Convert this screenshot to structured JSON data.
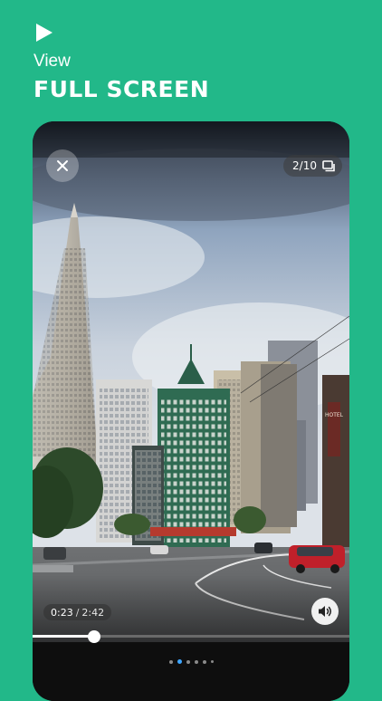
{
  "header": {
    "subtitle": "View",
    "title": "FULL SCREEN"
  },
  "viewer": {
    "counter": "2/10",
    "current_time": "0:23",
    "separator": "/",
    "duration": "2:42",
    "progress": 0.2,
    "page_dots": {
      "count": 6,
      "active_index": 1
    },
    "photo": {
      "sign_text": "HOTEL"
    },
    "icons": {
      "close": "close-icon",
      "gallery": "gallery-icon",
      "volume": "volume-icon",
      "play": "play-icon"
    }
  },
  "colors": {
    "brand_background": "#22b889",
    "seek_fill": "#ffffff",
    "active_dot": "#3ea6ff"
  }
}
